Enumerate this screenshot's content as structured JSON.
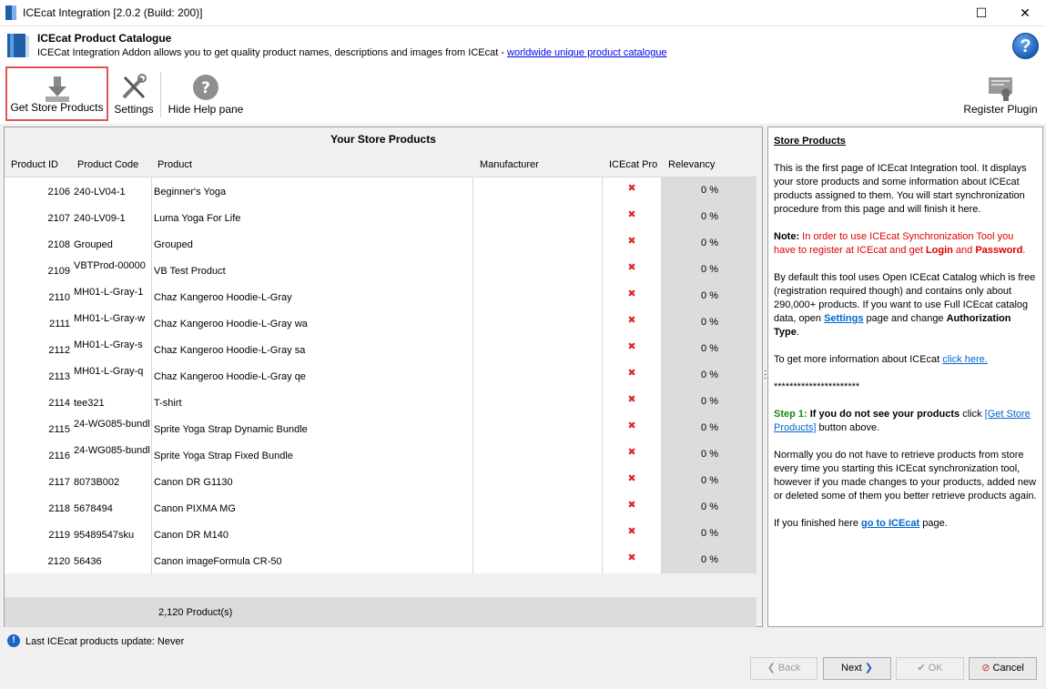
{
  "window": {
    "title": "ICEcat Integration [2.0.2 (Build: 200)]",
    "maximize_glyph": "☐",
    "close_glyph": "✕"
  },
  "header": {
    "title": "ICEcat Product Catalogue",
    "description": "ICECat Integration Addon allows you to get quality product names, descriptions and images from ICEcat - ",
    "link": "worldwide unique product catalogue",
    "help_glyph": "?"
  },
  "toolbar": {
    "get_store_products": "Get Store Products",
    "settings": "Settings",
    "hide_help_pane": "Hide Help pane",
    "register_plugin": "Register Plugin"
  },
  "grid": {
    "caption": "Your Store Products",
    "columns": [
      "Product ID",
      "Product Code",
      "Product",
      "Manufacturer",
      "ICEcat Pro",
      "Relevancy"
    ],
    "rows": [
      {
        "id": "2106",
        "code": "240-LV04-1",
        "product": "Beginner's Yoga",
        "ice": "✖",
        "rel": "0 %"
      },
      {
        "id": "2107",
        "code": "240-LV09-1",
        "product": "Luma Yoga For Life",
        "ice": "✖",
        "rel": "0 %"
      },
      {
        "id": "2108",
        "code": "Grouped",
        "product": "Grouped",
        "ice": "✖",
        "rel": "0 %"
      },
      {
        "id": "2109",
        "code": "VBTProd-00000",
        "product": "VB Test Product",
        "ice": "✖",
        "rel": "0 %"
      },
      {
        "id": "2110",
        "code": "MH01-L-Gray-1",
        "product": "Chaz Kangeroo Hoodie-L-Gray",
        "ice": "✖",
        "rel": "0 %"
      },
      {
        "id": "2111",
        "code": "MH01-L-Gray-w",
        "product": "Chaz Kangeroo Hoodie-L-Gray  wa",
        "ice": "✖",
        "rel": "0 %"
      },
      {
        "id": "2112",
        "code": "MH01-L-Gray-s",
        "product": "Chaz Kangeroo Hoodie-L-Gray  sa",
        "ice": "✖",
        "rel": "0 %"
      },
      {
        "id": "2113",
        "code": "MH01-L-Gray-q",
        "product": "Chaz Kangeroo Hoodie-L-Gray  qe",
        "ice": "✖",
        "rel": "0 %"
      },
      {
        "id": "2114",
        "code": "tee321",
        "product": "T-shirt",
        "ice": "✖",
        "rel": "0 %"
      },
      {
        "id": "2115",
        "code": "24-WG085-bundl",
        "product": "Sprite Yoga Strap Dynamic Bundle",
        "ice": "✖",
        "rel": "0 %"
      },
      {
        "id": "2116",
        "code": "24-WG085-bundl",
        "product": "Sprite Yoga Strap Fixed Bundle",
        "ice": "✖",
        "rel": "0 %"
      },
      {
        "id": "2117",
        "code": "8073B002",
        "product": "Canon DR G1130",
        "ice": "✖",
        "rel": "0 %"
      },
      {
        "id": "2118",
        "code": "5678494",
        "product": "Canon PIXMA MG",
        "ice": "✖",
        "rel": "0 %"
      },
      {
        "id": "2119",
        "code": "95489547sku",
        "product": "Canon DR M140",
        "ice": "✖",
        "rel": "0 %"
      },
      {
        "id": "2120",
        "code": "56436",
        "product": "Canon imageFormula CR-50",
        "ice": "✖",
        "rel": "0 %"
      }
    ],
    "footer_count": "2,120 Product(s)"
  },
  "help": {
    "heading": "Store Products",
    "p1": "This is the first page of ICEcat Integration tool. It displays your store products and some information about ICEcat products assigned to them. You will start synchronization procedure from this page and will finish it here.",
    "note_label": "Note:",
    "note_text": " In order to use ICEcat Synchronization Tool you have to register at ICEcat and get ",
    "login": "Login",
    "and": " and ",
    "password": "Password",
    "period": ".",
    "p3a": "By default this tool uses Open ICEcat Catalog which is free (registration required though) and contains only about 290,000+ products. If you want to use Full ICEcat catalog data, open ",
    "settings_link": "Settings",
    "p3b": " page and change ",
    "auth_type": "Authorization Type",
    "p4a": "To get more information about ICEcat ",
    "click_here": "click here.",
    "stars": "**********************",
    "step_label": "Step 1:",
    "step_bold": " If you do not see your products",
    "step_text": " click ",
    "step_link": "[Get Store Products]",
    "step_end": " button above.",
    "p6": "Normally you do not have to retrieve products from store every time you starting this ICEcat synchronization tool, however if you made changes to your products, added new or deleted some of them you better retrieve products again.",
    "p7a": "If you finished here ",
    "goto_link": "go to ICEcat",
    "p7b": " page."
  },
  "status": {
    "info_glyph": "!",
    "text": "Last ICEcat products update: Never"
  },
  "buttons": {
    "back": "Back",
    "next": "Next",
    "ok": "OK",
    "cancel": "Cancel"
  }
}
